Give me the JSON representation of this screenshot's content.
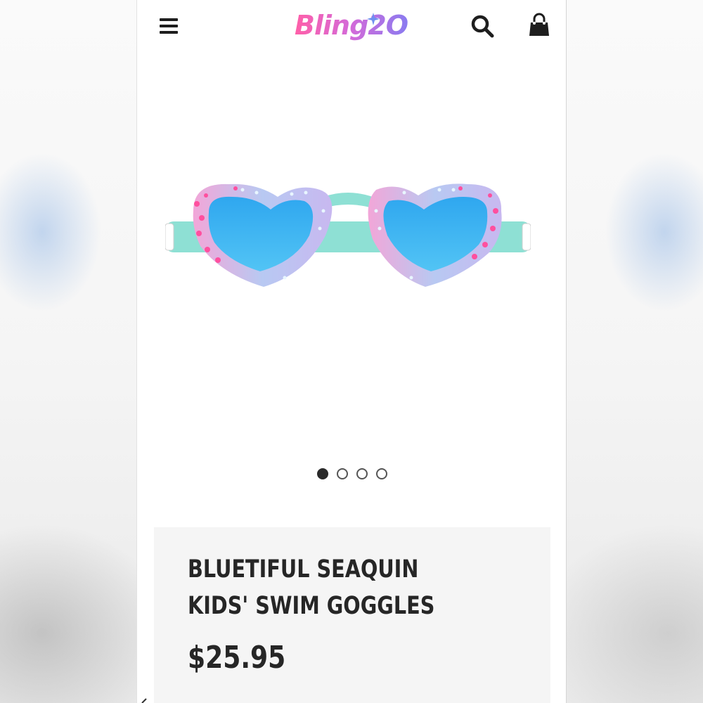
{
  "header": {
    "brand": "Bling2O",
    "menu_icon": "hamburger-menu-icon",
    "search_icon": "search-icon",
    "cart_icon": "shopping-bag-icon"
  },
  "gallery": {
    "image_subject": "heart-shaped pink and blue jeweled swim goggles",
    "slide_count": 4,
    "active_slide": 1
  },
  "product": {
    "title": "BLUETIFUL SEAQUIN KIDS' SWIM GOGGLES",
    "price": "$25.95"
  },
  "colors": {
    "text": "#262626",
    "card_bg": "#f5f5f5",
    "brand_pink": "#ff5fa8",
    "brand_blue": "#3a7be0"
  }
}
